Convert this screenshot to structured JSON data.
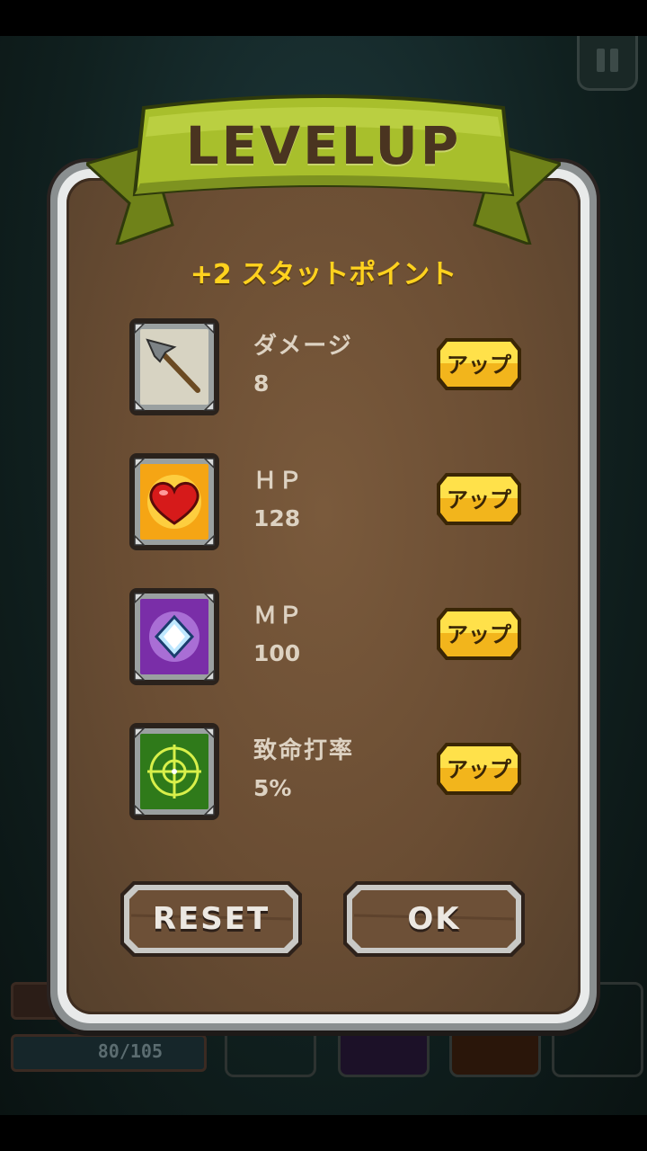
{
  "dialog": {
    "title": "LEVELUP",
    "points_label": "+2 スタットポイント"
  },
  "stats": [
    {
      "name": "ダメージ",
      "value": "8",
      "icon": "spear-icon",
      "button": "アップ"
    },
    {
      "name": "ＨＰ",
      "value": "128",
      "icon": "heart-icon",
      "button": "アップ"
    },
    {
      "name": "ＭＰ",
      "value": "100",
      "icon": "diamond-icon",
      "button": "アップ"
    },
    {
      "name": "致命打率",
      "value": "5%",
      "icon": "crosshair-icon",
      "button": "アップ"
    }
  ],
  "buttons": {
    "reset": "RESET",
    "ok": "OK"
  },
  "hud": {
    "mp_text": "80/105"
  },
  "colors": {
    "accent_yellow": "#ffd21e",
    "wood": "#6a4d33",
    "banner_green": "#a8bf2c"
  }
}
